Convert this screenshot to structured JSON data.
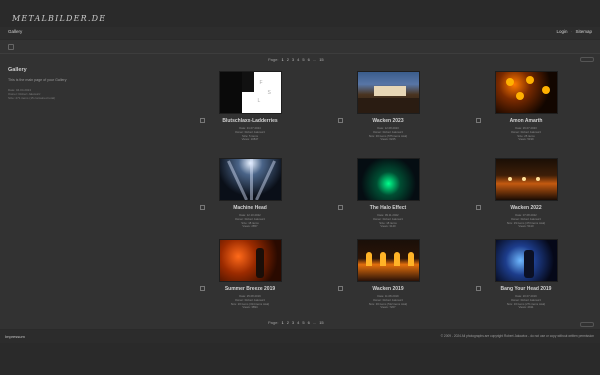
{
  "site": {
    "logo": "METALBILDER.DE"
  },
  "topbar": {
    "breadcrumb": "Gallery",
    "login": "Login",
    "separator": "·",
    "sitemap": "Sitemap"
  },
  "sidebar": {
    "title": "Gallery",
    "description": "This is the main page of your Gallery",
    "meta": [
      "Date: 04.04.2024",
      "Owner: Robert Jakowicz",
      "Size: 271 items (15 contained total)"
    ]
  },
  "pager": {
    "label": "Page:",
    "pages": [
      "1",
      "2",
      "3",
      "4",
      "5",
      "6"
    ],
    "ellipsis": "...",
    "last": "15",
    "current": "1"
  },
  "albums": [
    {
      "title": "Blutschlaxx-Ladderries",
      "info": [
        "Date: 31.07.2024",
        "Owner: Robert Jakowicz",
        "Size: 5 items",
        "Views: 10847"
      ]
    },
    {
      "title": "Wacken 2023",
      "info": [
        "Date: 12.08.2023",
        "Owner: Robert Jakowicz",
        "Size: 30 items (575 items total)",
        "Views: 6225"
      ]
    },
    {
      "title": "Amon Amarth",
      "info": [
        "Date: 26.07.2023",
        "Owner: Robert Jakowicz",
        "Size: 25 items",
        "Views: 5199"
      ]
    },
    {
      "title": "Machine Head",
      "info": [
        "Date: 12.10.2022",
        "Owner: Robert Jakowicz",
        "Size: 18 items",
        "Views: 2857"
      ]
    },
    {
      "title": "The Halo Effect",
      "info": [
        "Date: 09.11.2022",
        "Owner: Robert Jakowicz",
        "Size: 18 items",
        "Views: 3140"
      ]
    },
    {
      "title": "Wacken 2022",
      "info": [
        "Date: 07.08.2022",
        "Owner: Robert Jakowicz",
        "Size: 29 items (473 items total)",
        "Views: 5410"
      ]
    },
    {
      "title": "Summer Breeze 2019",
      "info": [
        "Date: 25.08.2019",
        "Owner: Robert Jakowicz",
        "Size: 20 items (314 items total)",
        "Views: 3894"
      ]
    },
    {
      "title": "Wacken 2019",
      "info": [
        "Date: 11.08.2019",
        "Owner: Robert Jakowicz",
        "Size: 30 items (512 items total)",
        "Views: 7207"
      ]
    },
    {
      "title": "Bang Your Head 2019",
      "info": [
        "Date: 20.07.2019",
        "Owner: Robert Jakowicz",
        "Size: 16 items (271 items total)",
        "Views: 2911"
      ]
    }
  ],
  "footer": {
    "impressum": "Impressum",
    "copyright": "© 2009 - 2024 All photographs are copyright Robert Jakowicz - do not use or copy without written permission"
  }
}
